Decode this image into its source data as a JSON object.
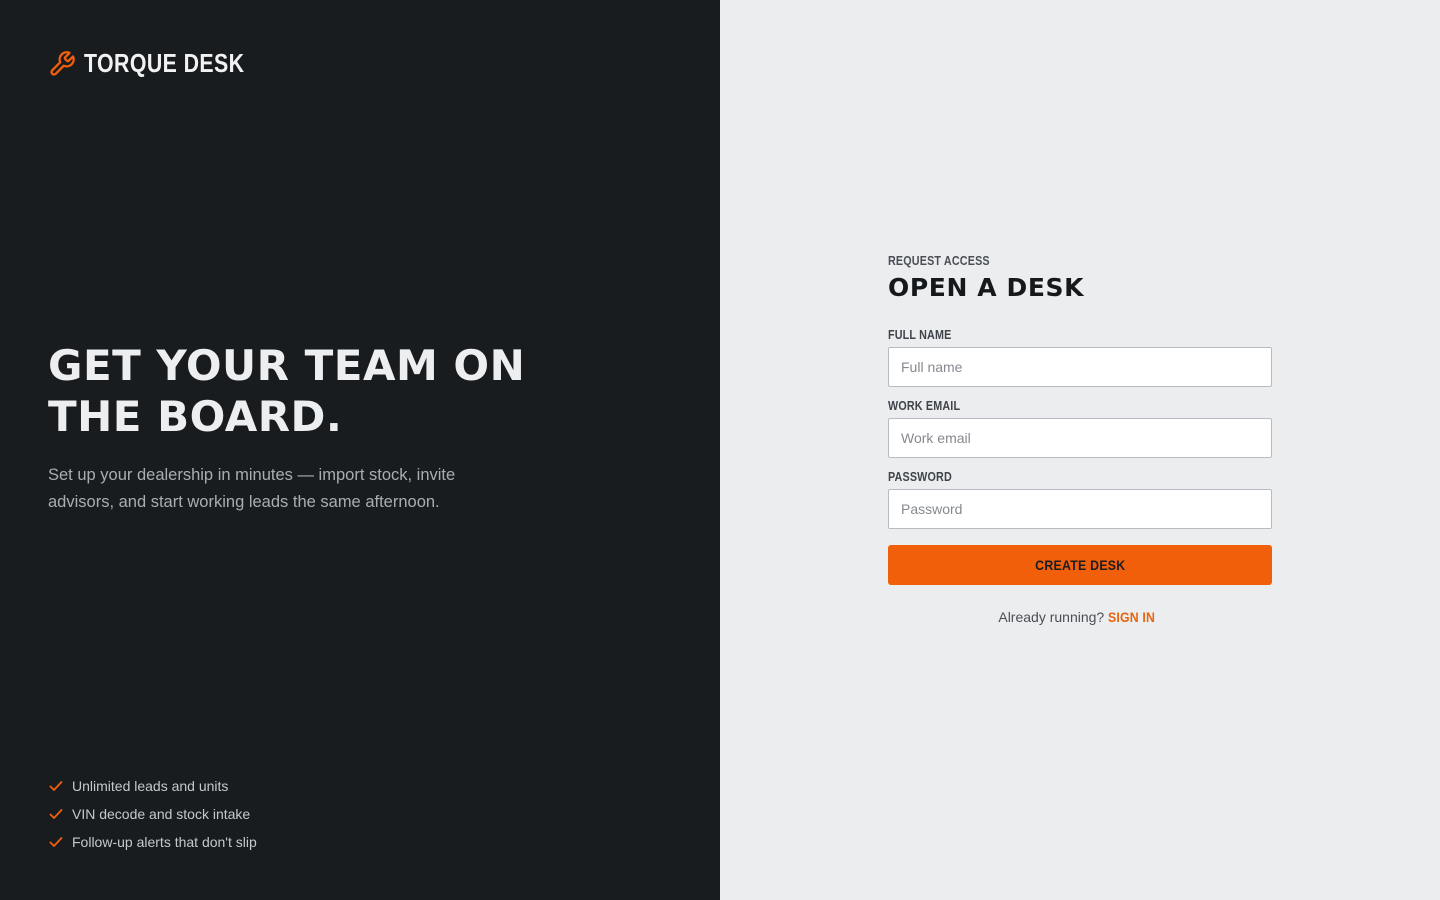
{
  "brand": {
    "name": "TORQUE DESK",
    "icon": "wrench-icon",
    "accent": "#f25f0a"
  },
  "hero": {
    "title": "GET YOUR TEAM ON THE BOARD.",
    "subtitle": "Set up your dealership in minutes — import stock, invite advisors, and start working leads the same afternoon."
  },
  "features": [
    {
      "icon": "check-icon",
      "label": "Unlimited leads and units"
    },
    {
      "icon": "check-icon",
      "label": "VIN decode and stock intake"
    },
    {
      "icon": "check-icon",
      "label": "Follow-up alerts that don't slip"
    }
  ],
  "form": {
    "eyebrow": "REQUEST ACCESS",
    "title": "OPEN A DESK",
    "full_name": {
      "label": "FULL NAME",
      "placeholder": "Full name",
      "value": ""
    },
    "work_email": {
      "label": "WORK EMAIL",
      "placeholder": "Work email",
      "value": ""
    },
    "password": {
      "label": "PASSWORD",
      "placeholder": "Password",
      "value": ""
    },
    "submit_label": "CREATE DESK",
    "alt_prompt": "Already running?",
    "alt_link": "SIGN IN"
  },
  "colors": {
    "left_bg": "#191c1f",
    "right_bg": "#ecedef",
    "accent": "#f25f0a"
  }
}
